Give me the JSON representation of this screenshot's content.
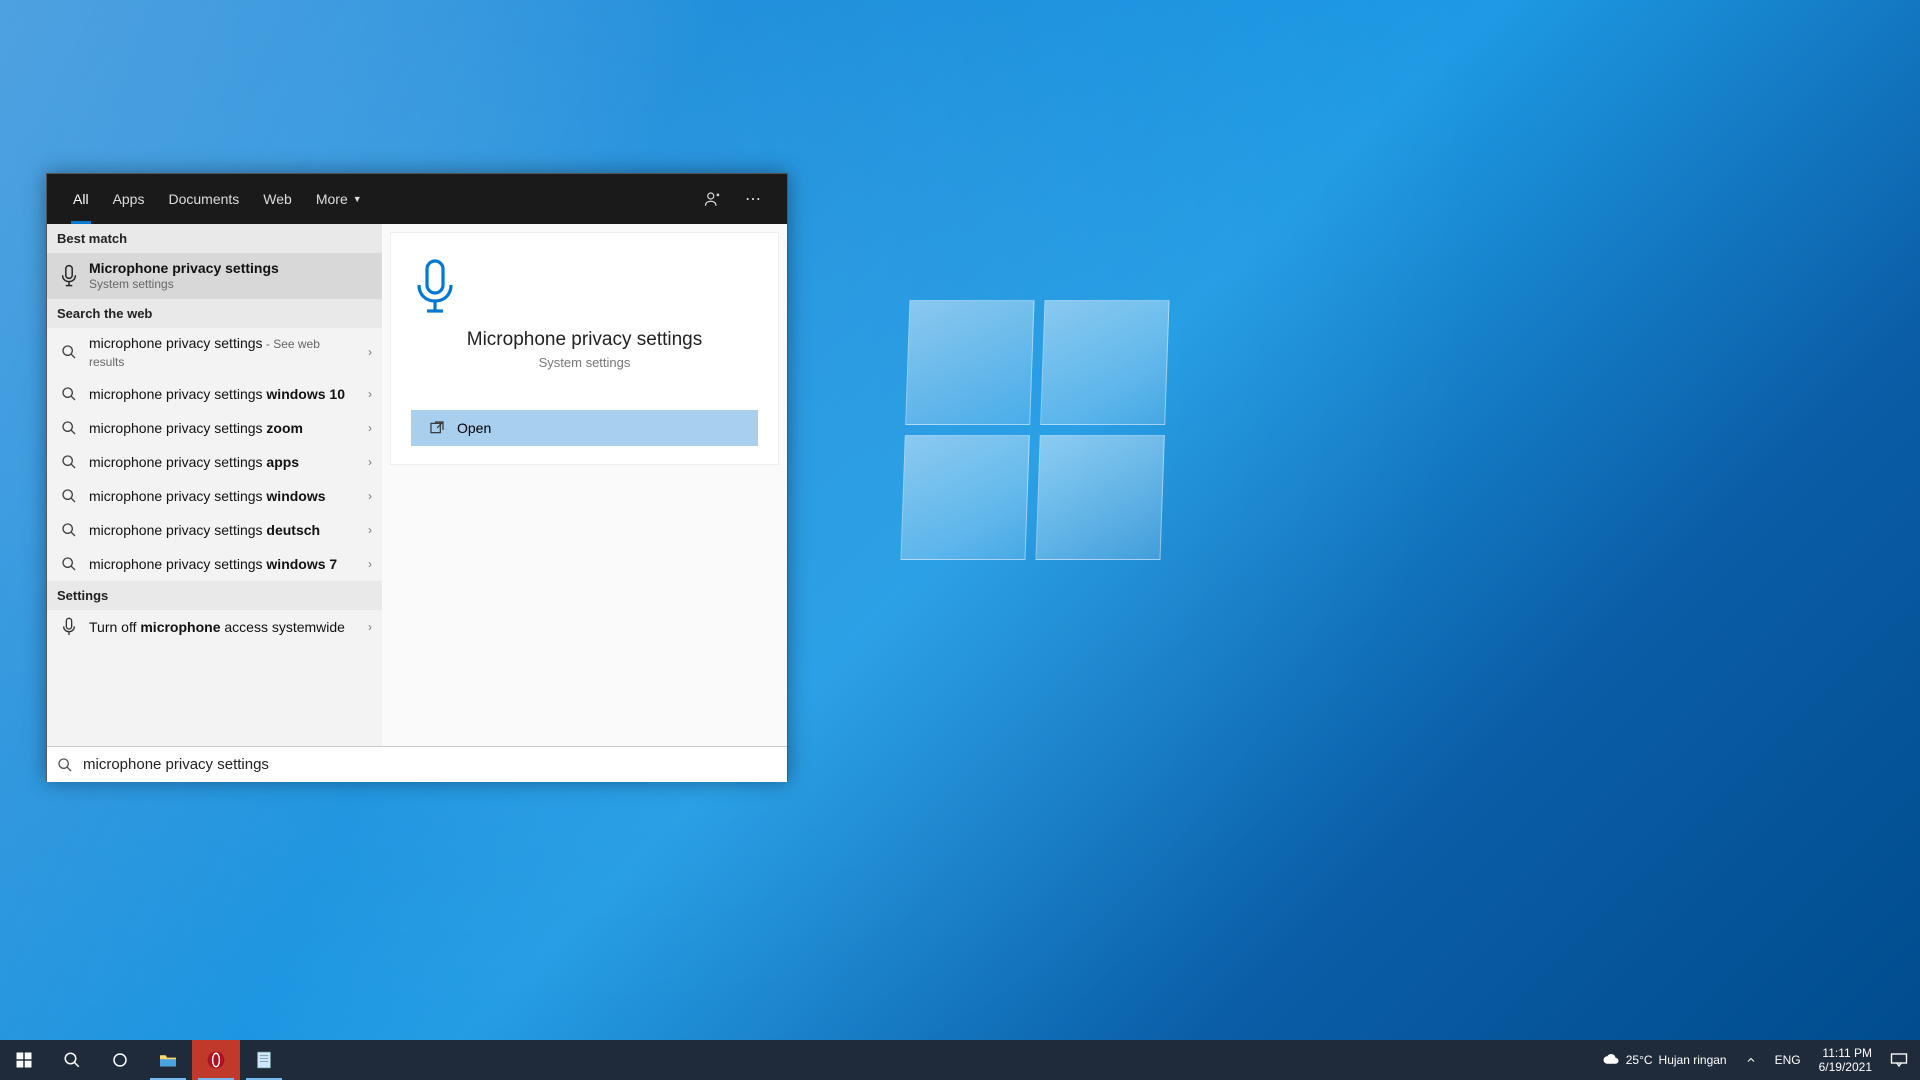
{
  "tabs": {
    "all": "All",
    "apps": "Apps",
    "documents": "Documents",
    "web": "Web",
    "more": "More"
  },
  "sections": {
    "best_match": "Best match",
    "search_web": "Search the web",
    "settings": "Settings"
  },
  "best_match": {
    "title": "Microphone privacy settings",
    "subtitle": "System settings"
  },
  "web_results": [
    {
      "prefix": "microphone privacy settings",
      "suffix": " - See web results"
    },
    {
      "prefix": "microphone privacy settings ",
      "bold": "windows 10"
    },
    {
      "prefix": "microphone privacy settings ",
      "bold": "zoom"
    },
    {
      "prefix": "microphone privacy settings ",
      "bold": "apps"
    },
    {
      "prefix": "microphone privacy settings ",
      "bold": "windows"
    },
    {
      "prefix": "microphone privacy settings ",
      "bold": "deutsch"
    },
    {
      "prefix": "microphone privacy settings ",
      "bold": "windows 7"
    }
  ],
  "settings_result": {
    "prefix": "Turn off ",
    "bold": "microphone",
    "suffix": " access systemwide"
  },
  "preview": {
    "title": "Microphone privacy settings",
    "subtitle": "System settings",
    "open": "Open"
  },
  "search_value": "microphone privacy settings",
  "tray": {
    "weather_temp": "25°C",
    "weather_desc": "Hujan ringan",
    "lang": "ENG",
    "time": "11:11 PM",
    "date": "6/19/2021"
  }
}
